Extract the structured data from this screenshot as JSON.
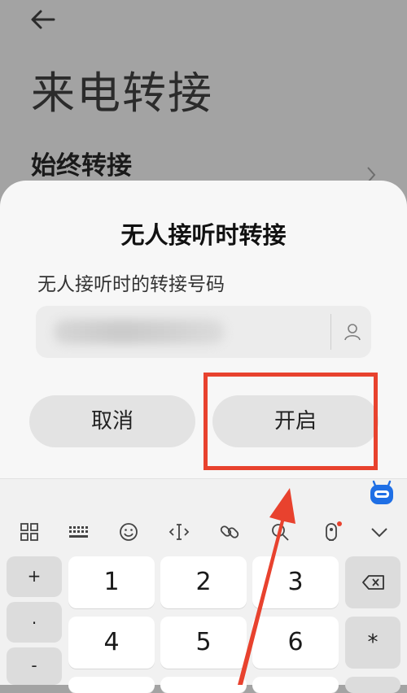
{
  "background": {
    "title": "来电转接",
    "item": "始终转接"
  },
  "dialog": {
    "title": "无人接听时转接",
    "field_label": "无人接听时的转接号码",
    "number_value": "13800000000",
    "cancel_label": "取消",
    "confirm_label": "开启"
  },
  "keyboard": {
    "toolbar_icons": [
      "grid-icon",
      "keyboard-icon",
      "emoji-icon",
      "cursor-icon",
      "link-icon",
      "search-icon",
      "voice-icon",
      "collapse-icon"
    ],
    "side_keys": [
      "+",
      ".",
      "-"
    ],
    "digits_row1": [
      "1",
      "2",
      "3"
    ],
    "digits_row2": [
      "4",
      "5",
      "6"
    ],
    "delete_icon": "backspace-icon",
    "star_key": "*"
  },
  "colors": {
    "highlight": "#e8422e",
    "background_dim": "#a3a3a3",
    "sheet": "#f7f7f7"
  }
}
